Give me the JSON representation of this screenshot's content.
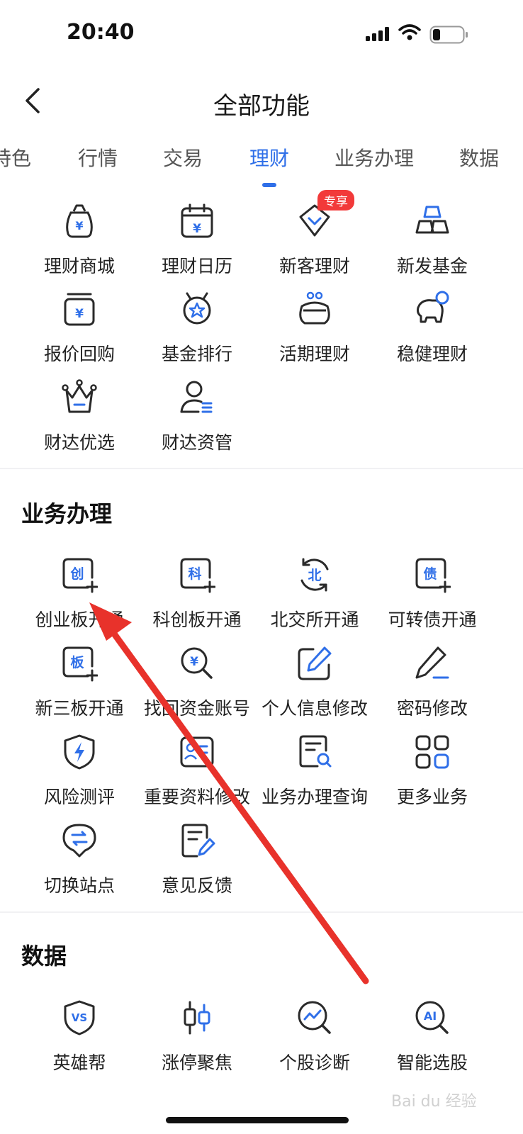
{
  "status_bar": {
    "time": "20:40"
  },
  "header": {
    "title": "全部功能"
  },
  "tabs": [
    {
      "label": "特色"
    },
    {
      "label": "行情"
    },
    {
      "label": "交易"
    },
    {
      "label": "理财"
    },
    {
      "label": "业务办理"
    },
    {
      "label": "数据"
    }
  ],
  "active_tab": "理财",
  "wealth_section": {
    "items": [
      {
        "label": "理财商城",
        "icon": "money-bag-icon"
      },
      {
        "label": "理财日历",
        "icon": "calendar-yuan-icon"
      },
      {
        "label": "新客理财",
        "icon": "shield-check-icon",
        "badge": "专享"
      },
      {
        "label": "新发基金",
        "icon": "gold-bars-icon"
      },
      {
        "label": "报价回购",
        "icon": "tray-yuan-icon"
      },
      {
        "label": "基金排行",
        "icon": "medal-star-icon"
      },
      {
        "label": "活期理财",
        "icon": "purse-icon"
      },
      {
        "label": "稳健理财",
        "icon": "piggy-bank-icon"
      },
      {
        "label": "财达优选",
        "icon": "crown-icon"
      },
      {
        "label": "财达资管",
        "icon": "person-list-icon"
      }
    ]
  },
  "business_section": {
    "title": "业务办理",
    "items": [
      {
        "label": "创业板开通",
        "icon": "chuang-plus-icon",
        "glyph": "创"
      },
      {
        "label": "科创板开通",
        "icon": "ke-plus-icon",
        "glyph": "科"
      },
      {
        "label": "北交所开通",
        "icon": "bei-cycle-icon",
        "glyph": "北"
      },
      {
        "label": "可转债开通",
        "icon": "zhai-plus-icon",
        "glyph": "债"
      },
      {
        "label": "新三板开通",
        "icon": "ban-plus-icon",
        "glyph": "板"
      },
      {
        "label": "找回资金账号",
        "icon": "search-yuan-icon"
      },
      {
        "label": "个人信息修改",
        "icon": "edit-square-icon"
      },
      {
        "label": "密码修改",
        "icon": "pencil-icon"
      },
      {
        "label": "风险测评",
        "icon": "shield-bolt-icon"
      },
      {
        "label": "重要资料修改",
        "icon": "id-card-icon"
      },
      {
        "label": "业务办理查询",
        "icon": "doc-search-icon"
      },
      {
        "label": "更多业务",
        "icon": "grid-icon"
      },
      {
        "label": "切换站点",
        "icon": "switch-pin-icon"
      },
      {
        "label": "意见反馈",
        "icon": "doc-edit-icon"
      }
    ]
  },
  "data_section": {
    "title": "数据",
    "items": [
      {
        "label": "英雄帮",
        "icon": "vs-shield-icon",
        "glyph": "VS"
      },
      {
        "label": "涨停聚焦",
        "icon": "candlestick-icon"
      },
      {
        "label": "个股诊断",
        "icon": "chart-magnifier-icon"
      },
      {
        "label": "智能选股",
        "icon": "ai-magnifier-icon",
        "glyph": "AI"
      }
    ]
  },
  "watermark": "Bai du 经验",
  "colors": {
    "accent": "#2f6fe8",
    "icon_stroke": "#2a2a2a",
    "badge": "#f23a3a",
    "annotation_arrow": "#e8322b"
  }
}
